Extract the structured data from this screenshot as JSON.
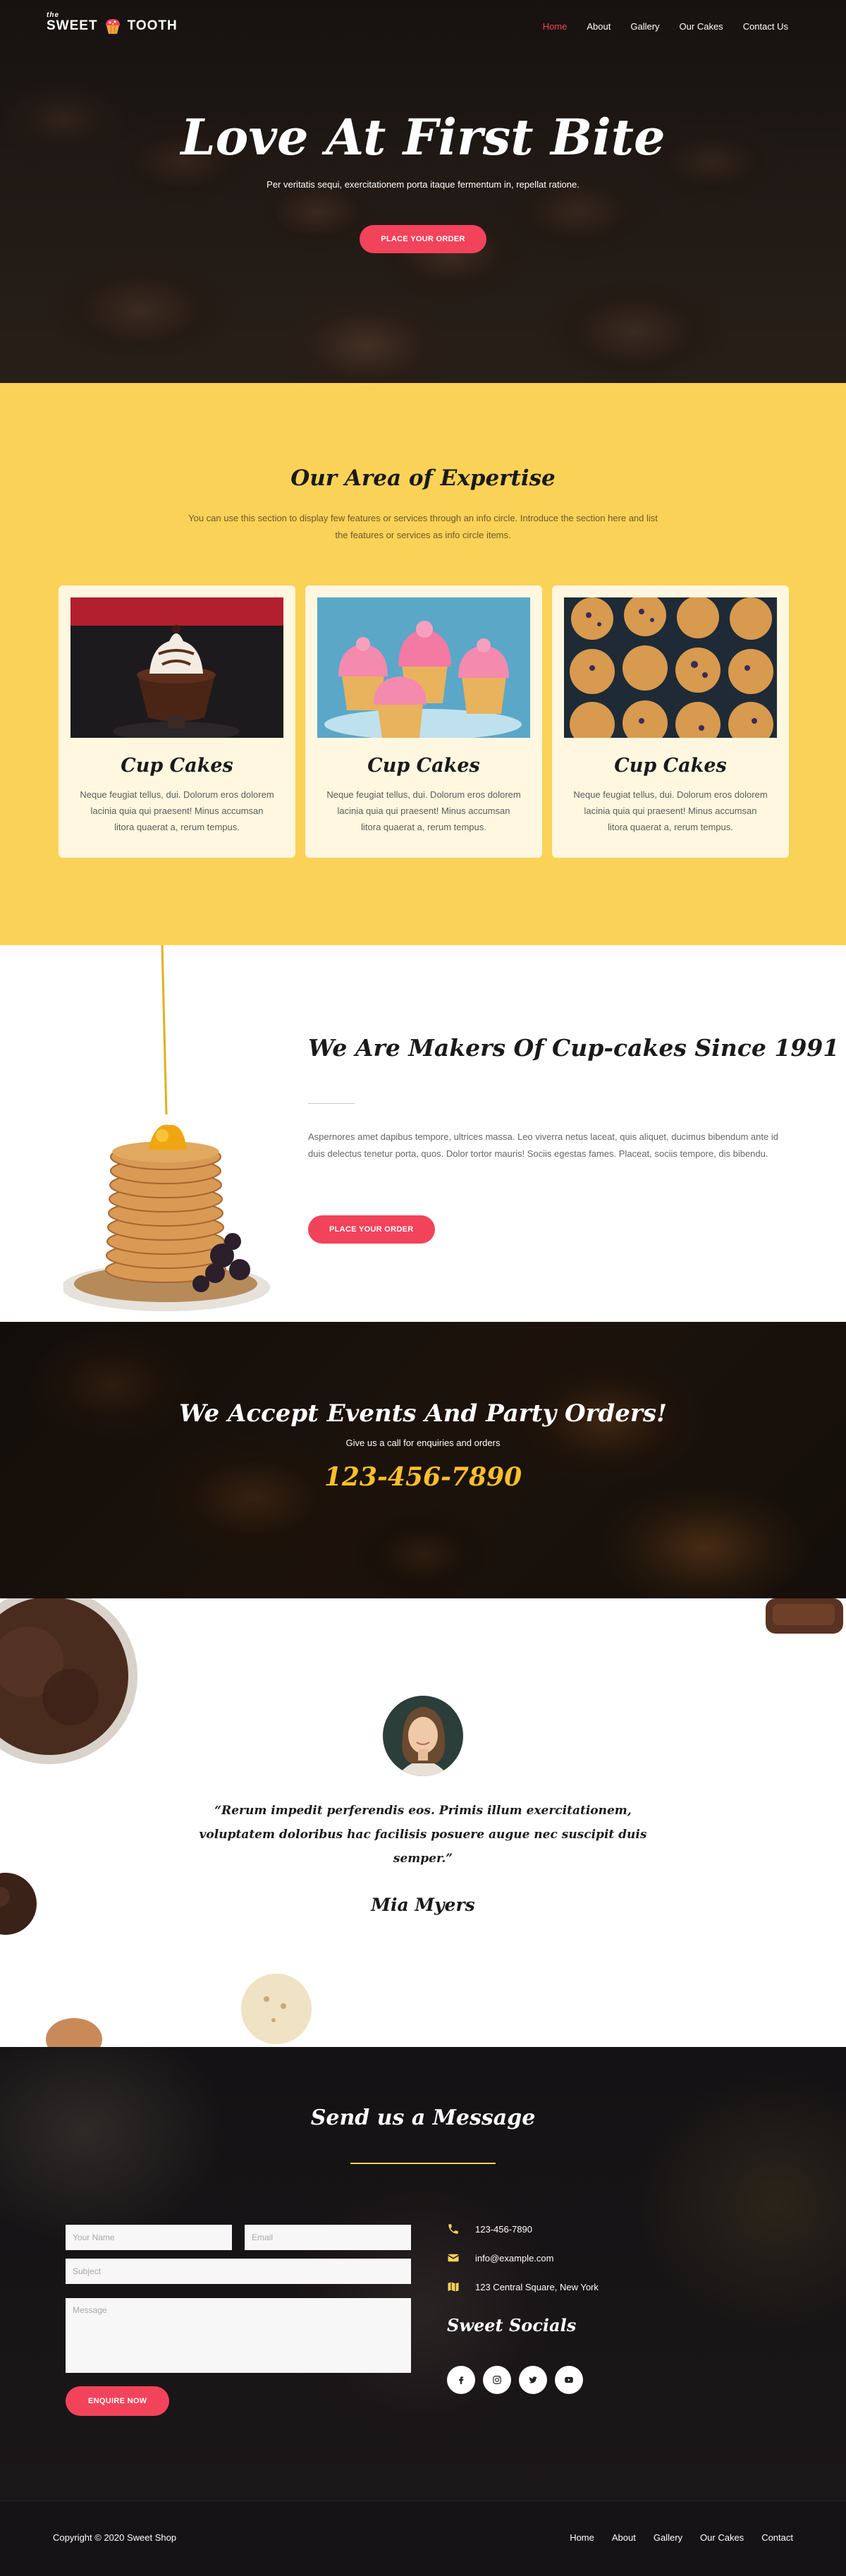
{
  "brand": {
    "prefix": "the",
    "name_left": "SWEET",
    "name_right": "TOOTH"
  },
  "nav": [
    {
      "label": "Home",
      "active": true
    },
    {
      "label": "About",
      "active": false
    },
    {
      "label": "Gallery",
      "active": false
    },
    {
      "label": "Our Cakes",
      "active": false
    },
    {
      "label": "Contact Us",
      "active": false
    }
  ],
  "hero": {
    "title": "Love At First Bite",
    "subtitle": "Per veritatis sequi, exercitationem porta itaque fermentum in, repellat ratione.",
    "cta": "PLACE YOUR ORDER"
  },
  "expertise": {
    "title": "Our Area of Expertise",
    "intro": "You can use this section to display few features or services through an info circle. Introduce the section here and list the features or services as info circle items.",
    "cards": [
      {
        "title": "Cup Cakes",
        "text": "Neque feugiat tellus, dui. Dolorum eros dolorem lacinia quia qui praesent! Minus accumsan litora quaerat a, rerum tempus."
      },
      {
        "title": "Cup Cakes",
        "text": "Neque feugiat tellus, dui. Dolorum eros dolorem lacinia quia qui praesent! Minus accumsan litora quaerat a, rerum tempus."
      },
      {
        "title": "Cup Cakes",
        "text": "Neque feugiat tellus, dui. Dolorum eros dolorem lacinia quia qui praesent! Minus accumsan litora quaerat a, rerum tempus."
      }
    ]
  },
  "makers": {
    "title": "We Are Makers Of Cup-cakes Since 1991",
    "text": "Aspernores amet dapibus tempore, ultrices massa. Leo viverra netus laceat, quis aliquet, ducimus bibendum ante id duis delectus tenetur porta, quos. Dolor tortor mauris! Sociis egestas fames. Placeat, sociis tempore, dis bibendu.",
    "cta": "PLACE YOUR ORDER"
  },
  "events": {
    "title": "We Accept Events And Party Orders!",
    "subtitle": "Give us a call for enquiries and orders",
    "phone": "123-456-7890"
  },
  "testimonial": {
    "quote": "“Rerum impedit perferendis eos. Primis illum exercitationem, voluptatem doloribus hac facilisis posuere augue nec suscipit duis semper.”",
    "author": "Mia Myers"
  },
  "contact": {
    "title": "Send us a Message",
    "fields": {
      "name": "Your Name",
      "email": "Email",
      "subject": "Subject",
      "message": "Message"
    },
    "submit": "ENQUIRE NOW",
    "phone": "123-456-7890",
    "email": "info@example.com",
    "address": "123 Central Square, New York",
    "socials_title": "Sweet Socials",
    "socials": [
      "facebook-icon",
      "instagram-icon",
      "twitter-icon",
      "youtube-icon"
    ]
  },
  "footer": {
    "copyright": "Copyright © 2020 Sweet Shop",
    "links": [
      "Home",
      "About",
      "Gallery",
      "Our Cakes",
      "Contact"
    ]
  },
  "colors": {
    "accent": "#f2435b",
    "yellow": "#fad257",
    "card": "#fff7df",
    "phone": "#fcbf2a"
  }
}
